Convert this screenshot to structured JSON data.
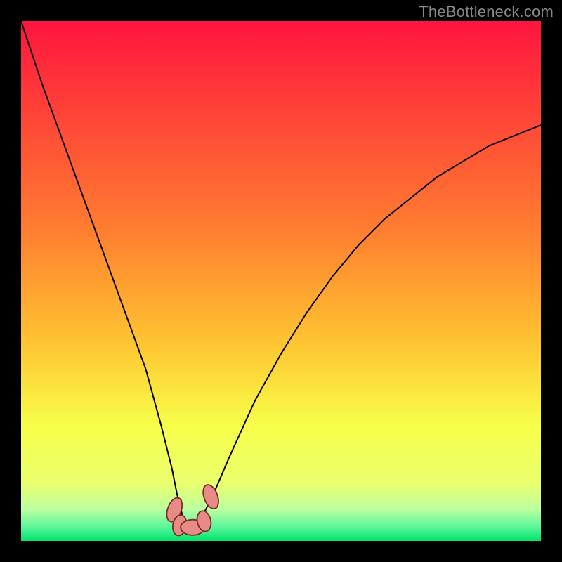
{
  "watermark": {
    "text": "TheBottleneck.com"
  },
  "colors": {
    "page_bg": "#000000",
    "gradient_top": "#ff153e",
    "gradient_mid": "#ffc531",
    "gradient_yellow": "#f7ff4a",
    "gradient_green_light": "#7aff7a",
    "gradient_green": "#00e46a",
    "curve_stroke": "#000000",
    "marker_fill": "#e88a86",
    "marker_stroke": "#7a2f2c",
    "watermark": "#878787"
  },
  "chart_data": {
    "type": "line",
    "title": "",
    "xlabel": "",
    "ylabel": "",
    "xlim": [
      0,
      100
    ],
    "ylim": [
      0,
      100
    ],
    "grid": false,
    "legend": false,
    "note": "Axes are unlabeled in the source image. Values are read as percentages of the plot area (0 = bottom/left, 100 = top/right). The curve is a V-shaped profile with its minimum near x ≈ 32.",
    "series": [
      {
        "name": "curve",
        "x": [
          0,
          4,
          8,
          12,
          16,
          20,
          24,
          27,
          29,
          30,
          31,
          32,
          33,
          34,
          35,
          37,
          40,
          45,
          50,
          55,
          60,
          65,
          70,
          75,
          80,
          85,
          90,
          95,
          100
        ],
        "y": [
          100,
          88,
          77,
          66,
          55,
          44,
          33,
          22,
          14,
          9,
          5,
          3,
          3,
          3,
          5,
          9,
          16,
          27,
          36,
          44,
          51,
          57,
          62,
          66,
          70,
          73,
          76,
          78,
          80
        ]
      }
    ],
    "markers": [
      {
        "x": 29.5,
        "y": 6.0,
        "rx": 1.3,
        "ry": 2.4,
        "rotation": 20
      },
      {
        "x": 30.5,
        "y": 3.0,
        "rx": 1.3,
        "ry": 2.0,
        "rotation": 10
      },
      {
        "x": 33.0,
        "y": 2.6,
        "rx": 2.3,
        "ry": 1.5,
        "rotation": 0
      },
      {
        "x": 35.2,
        "y": 3.8,
        "rx": 1.3,
        "ry": 2.0,
        "rotation": -12
      },
      {
        "x": 36.5,
        "y": 8.5,
        "rx": 1.3,
        "ry": 2.4,
        "rotation": -20
      }
    ],
    "gradient_stops": [
      {
        "offset": 0.0,
        "color": "#ff153e"
      },
      {
        "offset": 0.4,
        "color": "#ff7d30"
      },
      {
        "offset": 0.62,
        "color": "#ffc531"
      },
      {
        "offset": 0.78,
        "color": "#f7ff4a"
      },
      {
        "offset": 0.89,
        "color": "#eaff6e"
      },
      {
        "offset": 0.94,
        "color": "#baffa0"
      },
      {
        "offset": 0.975,
        "color": "#54f59a"
      },
      {
        "offset": 1.0,
        "color": "#00e46a"
      }
    ]
  }
}
